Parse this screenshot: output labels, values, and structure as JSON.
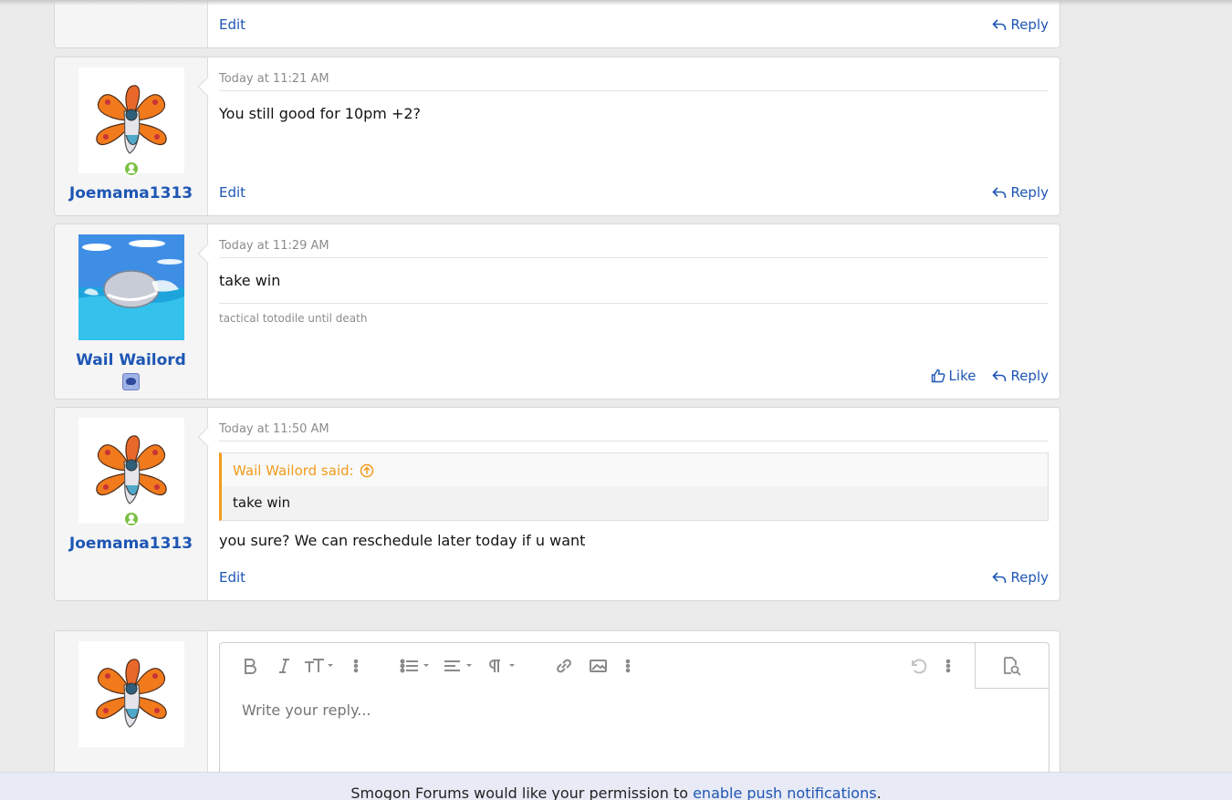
{
  "posts": [
    {
      "edit_label": "Edit",
      "reply_label": "Reply"
    },
    {
      "username": "Joemama1313",
      "time": "Today at 11:21 AM",
      "body": "You still good for 10pm +2?",
      "edit_label": "Edit",
      "reply_label": "Reply"
    },
    {
      "username": "Wail Wailord",
      "time": "Today at 11:29 AM",
      "body": "take win",
      "signature": "tactical totodile until death",
      "like_label": "Like",
      "reply_label": "Reply"
    },
    {
      "username": "Joemama1313",
      "time": "Today at 11:50 AM",
      "quote_author": "Wail Wailord said:",
      "quote_body": "take win",
      "body": "you sure? We can reschedule later today if u want",
      "edit_label": "Edit",
      "reply_label": "Reply"
    }
  ],
  "reply_editor": {
    "placeholder": "Write your reply..."
  },
  "push_bar": {
    "text": "Smogon Forums would like your permission to ",
    "link": "enable push notifications",
    "suffix": "."
  },
  "colors": {
    "link": "#1e56b4",
    "quote_accent": "#f29b1d",
    "online": "#7ac143"
  }
}
